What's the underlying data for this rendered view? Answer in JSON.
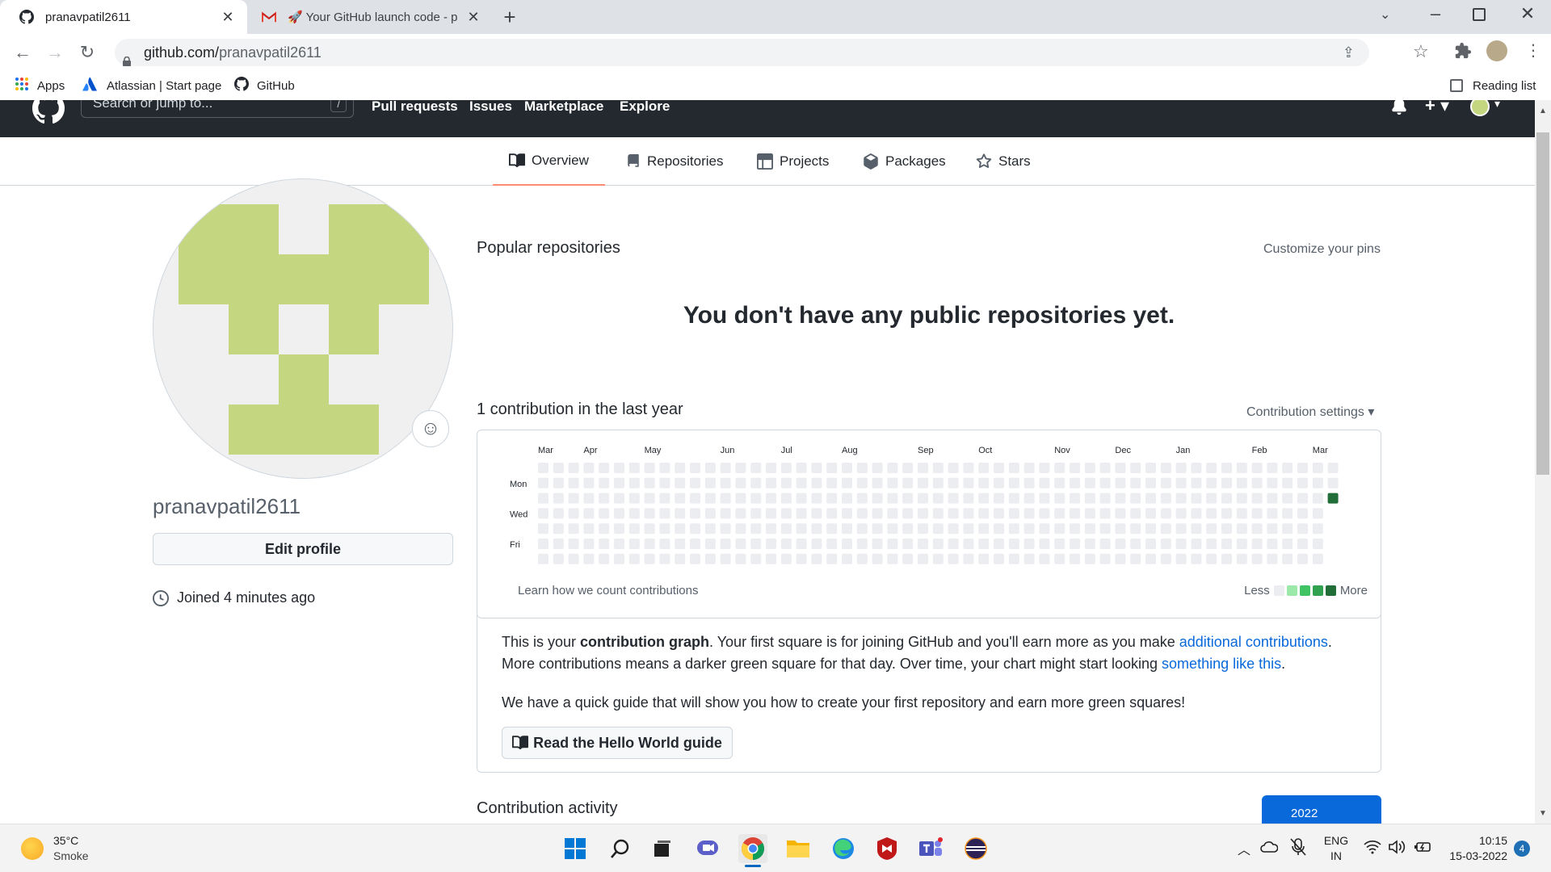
{
  "browser": {
    "tabs": [
      {
        "title": "pranavpatil2611",
        "active": true
      },
      {
        "title": "🚀 Your GitHub launch code - pa",
        "active": false
      }
    ],
    "url_domain": "github.com/",
    "url_path": "pranavpatil2611",
    "bookmarks": [
      {
        "label": "Apps"
      },
      {
        "label": "Atlassian | Start page"
      },
      {
        "label": "GitHub"
      }
    ],
    "reading_list": "Reading list"
  },
  "header": {
    "search_placeholder": "Search or jump to...",
    "slash_key": "/",
    "nav": [
      "Pull requests",
      "Issues",
      "Marketplace",
      "Explore"
    ]
  },
  "profile_tabs": [
    {
      "label": "Overview",
      "icon": "book-icon",
      "selected": true
    },
    {
      "label": "Repositories",
      "icon": "repo-icon",
      "selected": false
    },
    {
      "label": "Projects",
      "icon": "table-icon",
      "selected": false
    },
    {
      "label": "Packages",
      "icon": "package-icon",
      "selected": false
    },
    {
      "label": "Stars",
      "icon": "star-icon",
      "selected": false
    }
  ],
  "profile": {
    "username": "pranavpatil2611",
    "edit_button": "Edit profile",
    "joined": "Joined 4 minutes ago",
    "avatar_color": "#c5d681"
  },
  "popular": {
    "title": "Popular repositories",
    "customize": "Customize your pins",
    "empty_message": "You don't have any public repositories yet."
  },
  "contributions": {
    "title": "1 contribution in the last year",
    "settings": "Contribution settings",
    "months": [
      "Mar",
      "Apr",
      "May",
      "Jun",
      "Jul",
      "Aug",
      "Sep",
      "Oct",
      "Nov",
      "Dec",
      "Jan",
      "Feb",
      "Mar"
    ],
    "days": [
      "Mon",
      "Wed",
      "Fri"
    ],
    "learn": "Learn how we count contributions",
    "less": "Less",
    "more": "More",
    "weeks": 53,
    "active_cell": {
      "week": 52,
      "day": 2
    },
    "empty_color": "#ebedf0",
    "active_color": "#216e39",
    "legend_colors": [
      "#ebedf0",
      "#9be9a8",
      "#40c463",
      "#30a14e",
      "#216e39"
    ]
  },
  "info": {
    "p1_a": "This is your ",
    "p1_b": "contribution graph",
    "p1_c": ". Your first square is for joining GitHub and you'll earn more as you make ",
    "p1_link1": "additional contributions",
    "p1_d": ". More contributions means a darker green square for that day. Over time, your chart might start looking ",
    "p1_link2": "something like this",
    "p1_e": ".",
    "p2": "We have a quick guide that will show you how to create your first repository and earn more green squares!",
    "guide_button": "Read the Hello World guide"
  },
  "activity": {
    "title": "Contribution activity",
    "year": "2022"
  },
  "taskbar": {
    "temp": "35°C",
    "weather": "Smoke",
    "lang1": "ENG",
    "lang2": "IN",
    "time": "10:15",
    "date": "15-03-2022",
    "notif_count": "4"
  }
}
